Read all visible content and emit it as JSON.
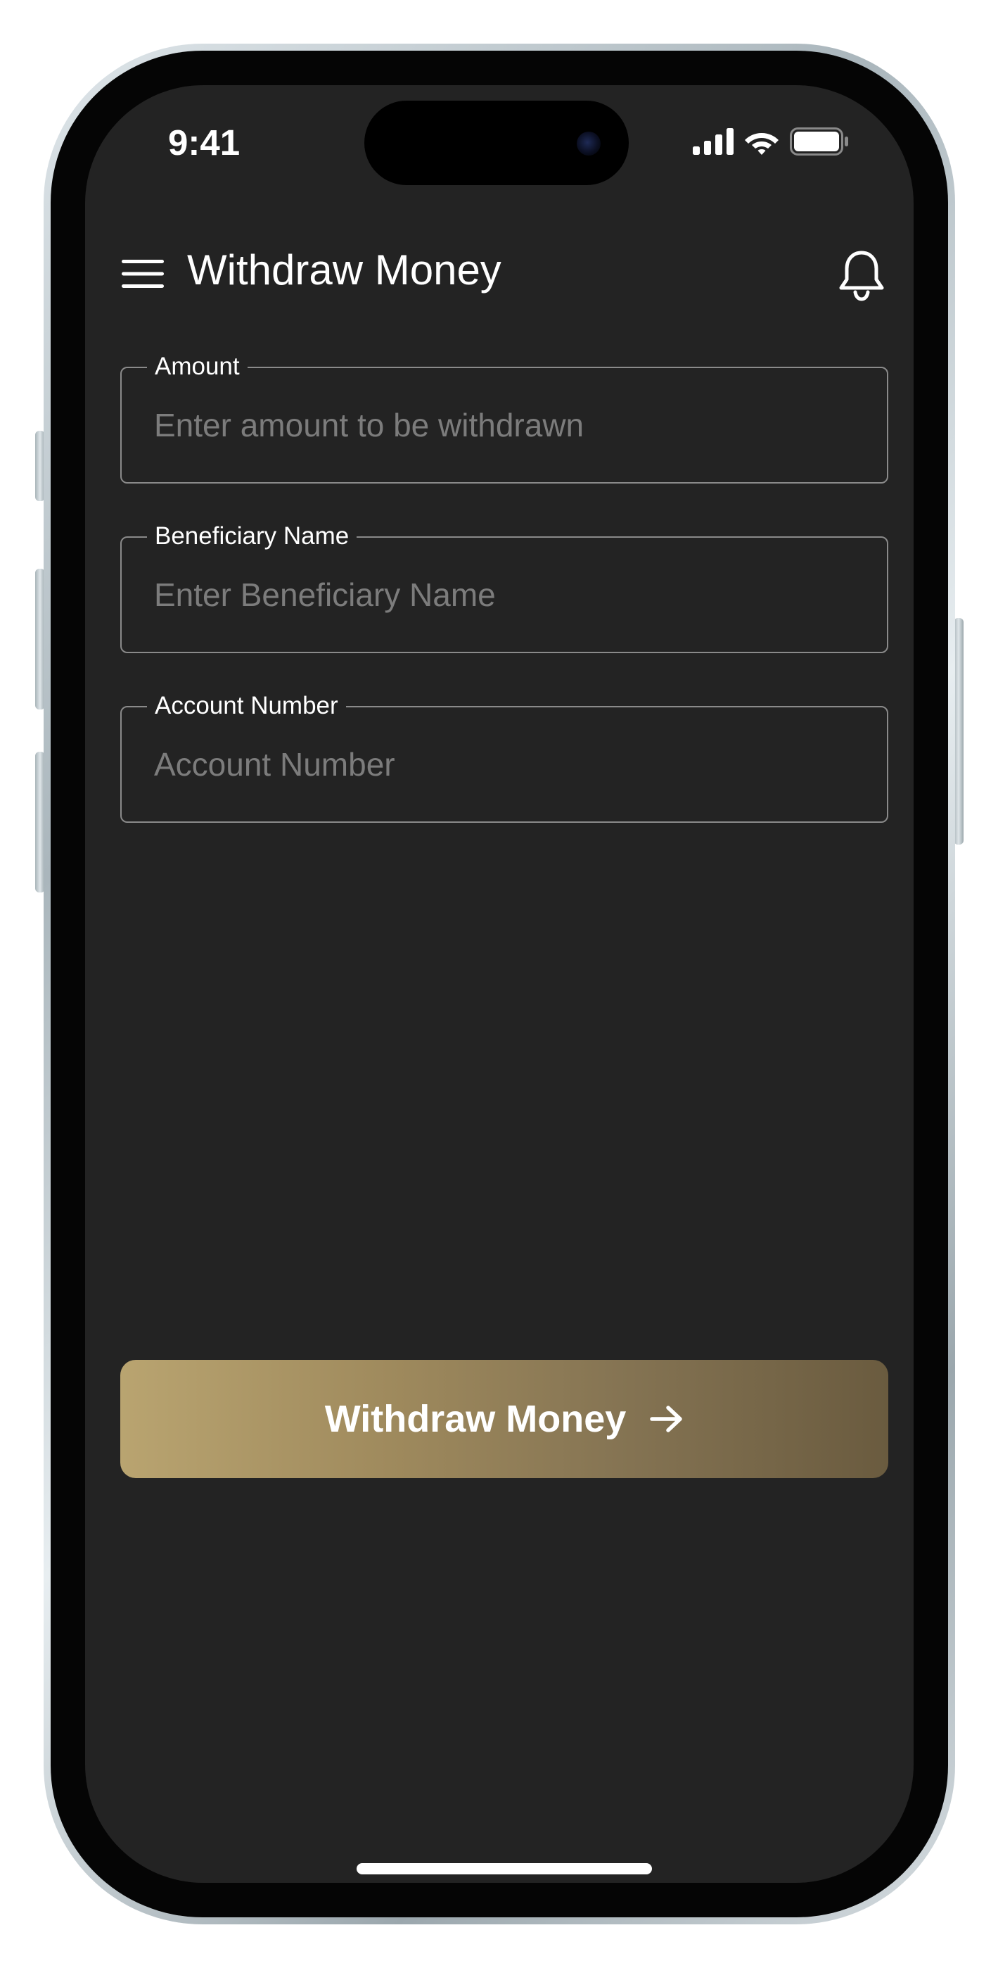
{
  "status_bar": {
    "time": "9:41"
  },
  "header": {
    "title": "Withdraw Money",
    "menu_icon": "hamburger-menu-icon",
    "notification_icon": "bell-icon"
  },
  "form": {
    "fields": [
      {
        "label": "Amount",
        "placeholder": "Enter amount to be withdrawn",
        "value": ""
      },
      {
        "label": "Beneficiary Name",
        "placeholder": "Enter Beneficiary Name",
        "value": ""
      },
      {
        "label": "Account Number",
        "placeholder": "Account Number",
        "value": ""
      }
    ]
  },
  "submit": {
    "label": "Withdraw Money",
    "icon": "arrow-right-icon"
  },
  "colors": {
    "background": "#232323",
    "field_border": "#8a8a8a",
    "placeholder": "#7c7c7c",
    "button_gradient_start": "#b9a470",
    "button_gradient_end": "#6a5b3f",
    "text": "#ffffff"
  }
}
